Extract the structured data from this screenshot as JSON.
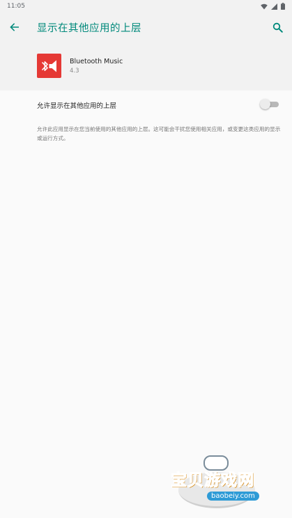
{
  "status_bar": {
    "time": "11:05",
    "icons": [
      "wifi-icon",
      "signal-icon",
      "battery-icon"
    ]
  },
  "app_bar": {
    "title": "显示在其他应用的上层",
    "back_icon": "arrow-back-icon",
    "search_icon": "search-icon",
    "accent_color": "#00897b"
  },
  "app_info": {
    "name": "Bluetooth Music",
    "version": "4.3",
    "icon": "bluetooth-music-app-icon",
    "icon_color": "#e53935"
  },
  "setting": {
    "label": "允许显示在其他应用的上层",
    "enabled": false
  },
  "description": "允许此应用显示在您当前使用的其他应用的上层。这可能会干扰您使用相关应用，或变更这类应用的显示或运行方式。",
  "watermark": {
    "text": "宝贝游戏网",
    "url": "baobeiy.com"
  }
}
